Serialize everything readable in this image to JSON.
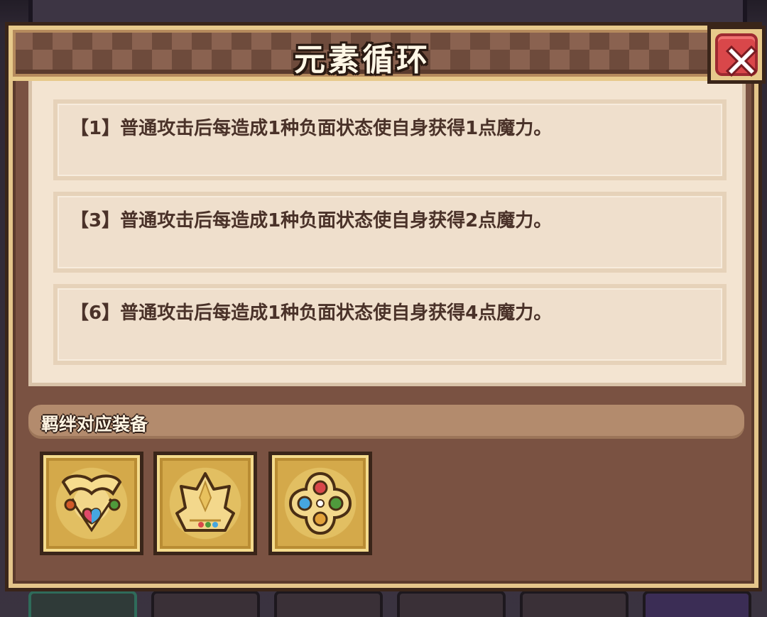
{
  "dialog": {
    "title": "元素循环",
    "close_icon": "close-x-icon"
  },
  "effects": [
    {
      "text": "【1】普通攻击后每造成1种负面状态使自身获得1点魔力。"
    },
    {
      "text": "【3】普通攻击后每造成1种负面状态使自身获得2点魔力。"
    },
    {
      "text": "【6】普通攻击后每造成1种负面状态使自身获得4点魔力。"
    }
  ],
  "equipment": {
    "section_title": "羁绊对应装备",
    "items": [
      {
        "icon": "gem-necklace-icon"
      },
      {
        "icon": "golden-crown-icon"
      },
      {
        "icon": "gem-cross-amulet-icon"
      }
    ]
  },
  "colors": {
    "panel": "#7a5242",
    "panel_border": "#e4c58a",
    "text_dark": "#4a3229",
    "close_red": "#d9474a"
  }
}
